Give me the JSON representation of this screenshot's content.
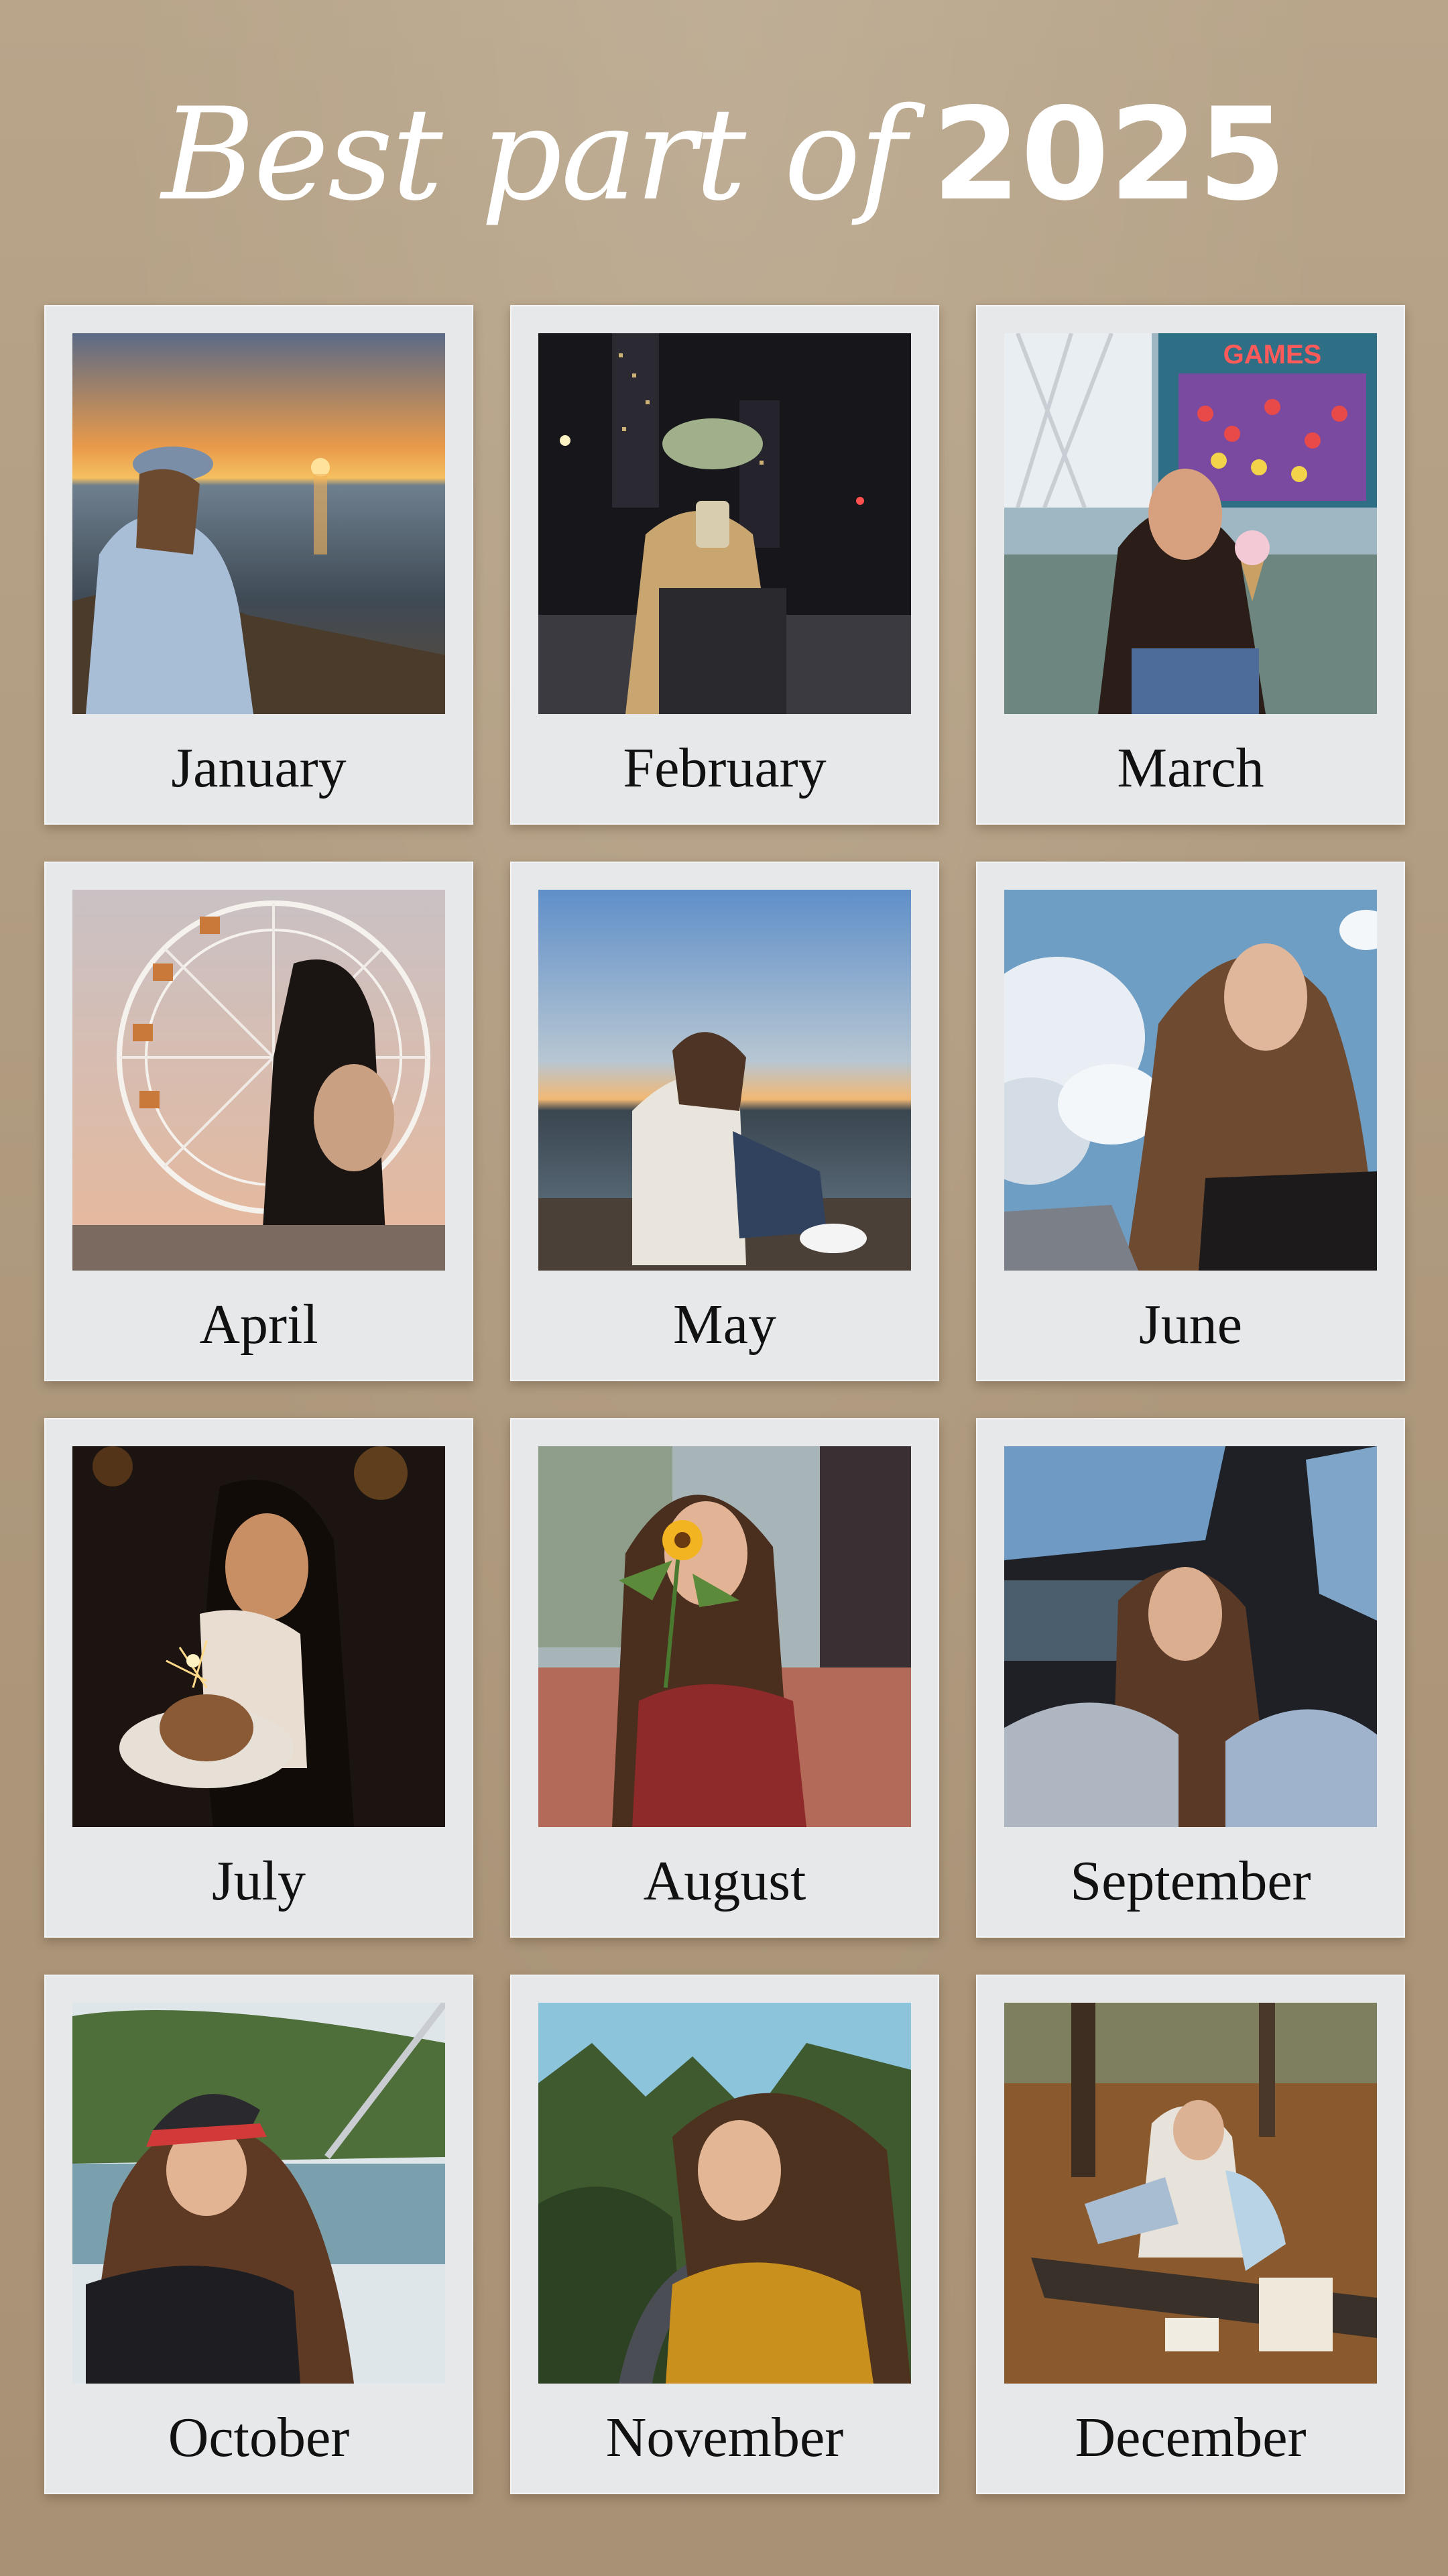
{
  "header": {
    "title_script": "Best part of",
    "title_year": "2025"
  },
  "months": [
    {
      "label": "January"
    },
    {
      "label": "February"
    },
    {
      "label": "March"
    },
    {
      "label": "April"
    },
    {
      "label": "May"
    },
    {
      "label": "June"
    },
    {
      "label": "July"
    },
    {
      "label": "August"
    },
    {
      "label": "September"
    },
    {
      "label": "October"
    },
    {
      "label": "November"
    },
    {
      "label": "December"
    }
  ],
  "colors": {
    "background": "#b09c81",
    "card": "#e6e8ea",
    "title": "#ffffff",
    "label": "#111111"
  }
}
